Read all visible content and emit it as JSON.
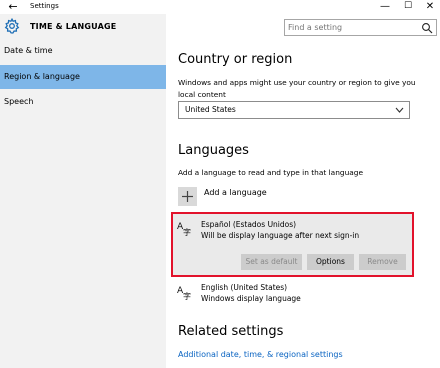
{
  "window": {
    "title": "Settings",
    "back_glyph": "←",
    "min_glyph": "—",
    "max_glyph": "☐",
    "close_glyph": "✕"
  },
  "header": {
    "section_title": "TIME & LANGUAGE",
    "search_placeholder": "Find a setting"
  },
  "sidebar": {
    "items": [
      {
        "label": "Date & time",
        "selected": false
      },
      {
        "label": "Region & language",
        "selected": true
      },
      {
        "label": "Speech",
        "selected": false
      }
    ]
  },
  "main": {
    "country": {
      "heading": "Country or region",
      "description": "Windows and apps might use your country or region to give you local content",
      "selected_value": "United States"
    },
    "languages": {
      "heading": "Languages",
      "description": "Add a language to read and type in that language",
      "add_label": "Add a language",
      "items": [
        {
          "name": "Español (Estados Unidos)",
          "status": "Will be display language after next sign-in",
          "selected": true,
          "buttons": {
            "set_default": "Set as default",
            "options": "Options",
            "remove": "Remove"
          }
        },
        {
          "name": "English (United States)",
          "status": "Windows display language",
          "selected": false
        }
      ]
    },
    "related": {
      "heading": "Related settings",
      "link": "Additional date, time, & regional settings"
    }
  },
  "colors": {
    "accent": "#7eb6e8",
    "highlight_border": "#e2122b",
    "link": "#0a64c2",
    "sidebar_bg": "#f2f2f2"
  }
}
